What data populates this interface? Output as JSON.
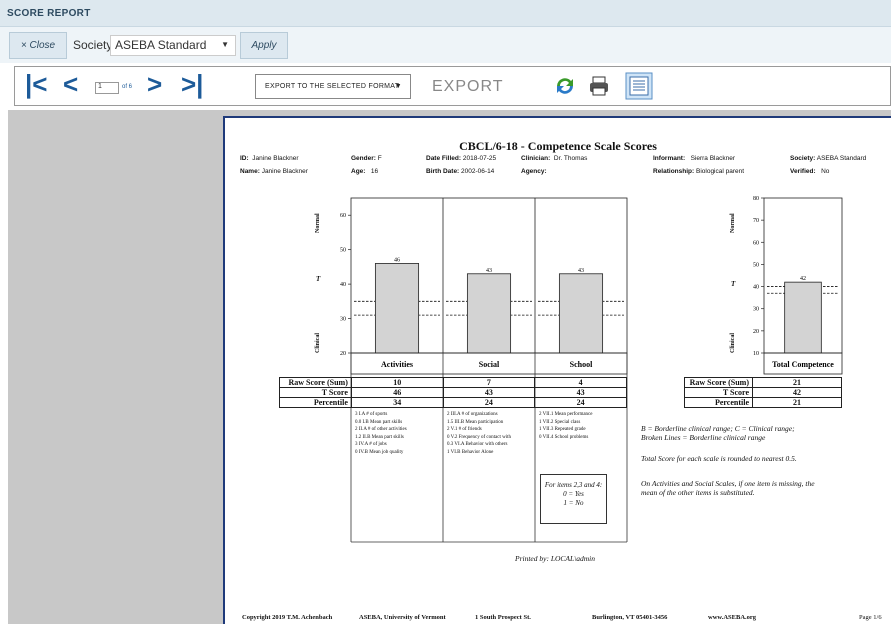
{
  "window": {
    "title": "SCORE REPORT"
  },
  "filter": {
    "close_label": "× Close",
    "society_label": "Society",
    "society_value": "ASEBA Standard",
    "apply_label": "Apply"
  },
  "toolbar": {
    "page_value": "1",
    "page_of": "of 6",
    "format_label": "Export to the selected format",
    "export_label": "Export"
  },
  "report": {
    "title": "CBCL/6-18 - Competence Scale Scores",
    "id_label": "ID:",
    "id_value": "Janine Blackner",
    "gender_label": "Gender:",
    "gender_value": "F",
    "date_filled_label": "Date Filled:",
    "date_filled_value": "2018-07-25",
    "clinician_label": "Clinician:",
    "clinician_value": "Dr. Thomas",
    "informant_label": "Informant:",
    "informant_value": "Sierra Blackner",
    "society_label": "Society:",
    "society_value": "ASEBA Standard",
    "name_label": "Name:",
    "name_value": "Janine Blackner",
    "age_label": "Age:",
    "age_value": "16",
    "birth_label": "Birth Date:",
    "birth_value": "2002-06-14",
    "agency_label": "Agency:",
    "agency_value": "",
    "relationship_label": "Relationship:",
    "relationship_value": "Biological parent",
    "verified_label": "Verified:",
    "verified_value": "No",
    "axis_normal": "Normal",
    "axis_t": "T",
    "axis_clinical": "Clinical",
    "row_labels": [
      "Raw Score (Sum)",
      "T Score",
      "Percentile"
    ],
    "activities_items": [
      "3   I.A # of sports",
      "0.0  I.B Mean part skills",
      "2   II.A # of other activities",
      "1.2  II.B Mean part skills",
      "3   IV.A # of jobs",
      "0   IV.B Mean job quality"
    ],
    "social_items": [
      "2   III.A # of organizations",
      "1.5  III.B Mean participation",
      "2   V.1 # of friends",
      "0   V.2 Frequency of contact with",
      "0.3  VI.A Behavior with others",
      "1   VI.B Behavior Alone"
    ],
    "school_items": [
      "2   VII.1 Mean performance",
      "1   VII.2 Special class",
      "1   VII.3 Repeated grade",
      "0   VII.4 School problems"
    ],
    "items_note": [
      "For items 2,3 and 4:",
      "0 = Yes",
      "1 = No"
    ],
    "notes": [
      "B = Borderline clinical range; C = Clinical range;",
      "Broken Lines = Borderline clinical range",
      "Total Score for each scale is rounded to nearest 0.5.",
      "On Activities and Social Scales, if one item is missing, the",
      "mean of the other items is substituted."
    ],
    "printed_by": "Printed by: LOCAL\\admin",
    "footer": [
      "Copyright 2019 T.M. Achenbach",
      "ASEBA, University of Vermont",
      "1 South Prospect St.",
      "Burlington, VT 05401-3456",
      "www.ASEBA.org",
      "Page 1/6"
    ]
  },
  "chart_data": [
    {
      "type": "bar",
      "categories": [
        "Activities",
        "Social",
        "School"
      ],
      "values": [
        46,
        43,
        43
      ],
      "raw_scores": [
        10,
        7,
        4
      ],
      "t_scores": [
        46,
        43,
        43
      ],
      "percentiles": [
        34,
        24,
        24
      ],
      "ylim": [
        20,
        65
      ],
      "yticks": [
        20,
        30,
        40,
        50,
        60
      ],
      "borderline_lines": [
        31,
        35
      ],
      "grid": false
    },
    {
      "type": "bar",
      "categories": [
        "Total Competence"
      ],
      "values": [
        42
      ],
      "raw_scores": [
        21
      ],
      "t_scores": [
        42
      ],
      "percentiles": [
        21
      ],
      "ylim": [
        10,
        80
      ],
      "yticks": [
        10,
        20,
        30,
        40,
        50,
        60,
        70,
        80
      ],
      "borderline_lines": [
        37,
        40
      ],
      "grid": false
    }
  ],
  "colors": {
    "accent": "#1d5b99",
    "bar_fill": "#d3d3d3",
    "header_bg": "#dde8ef"
  }
}
